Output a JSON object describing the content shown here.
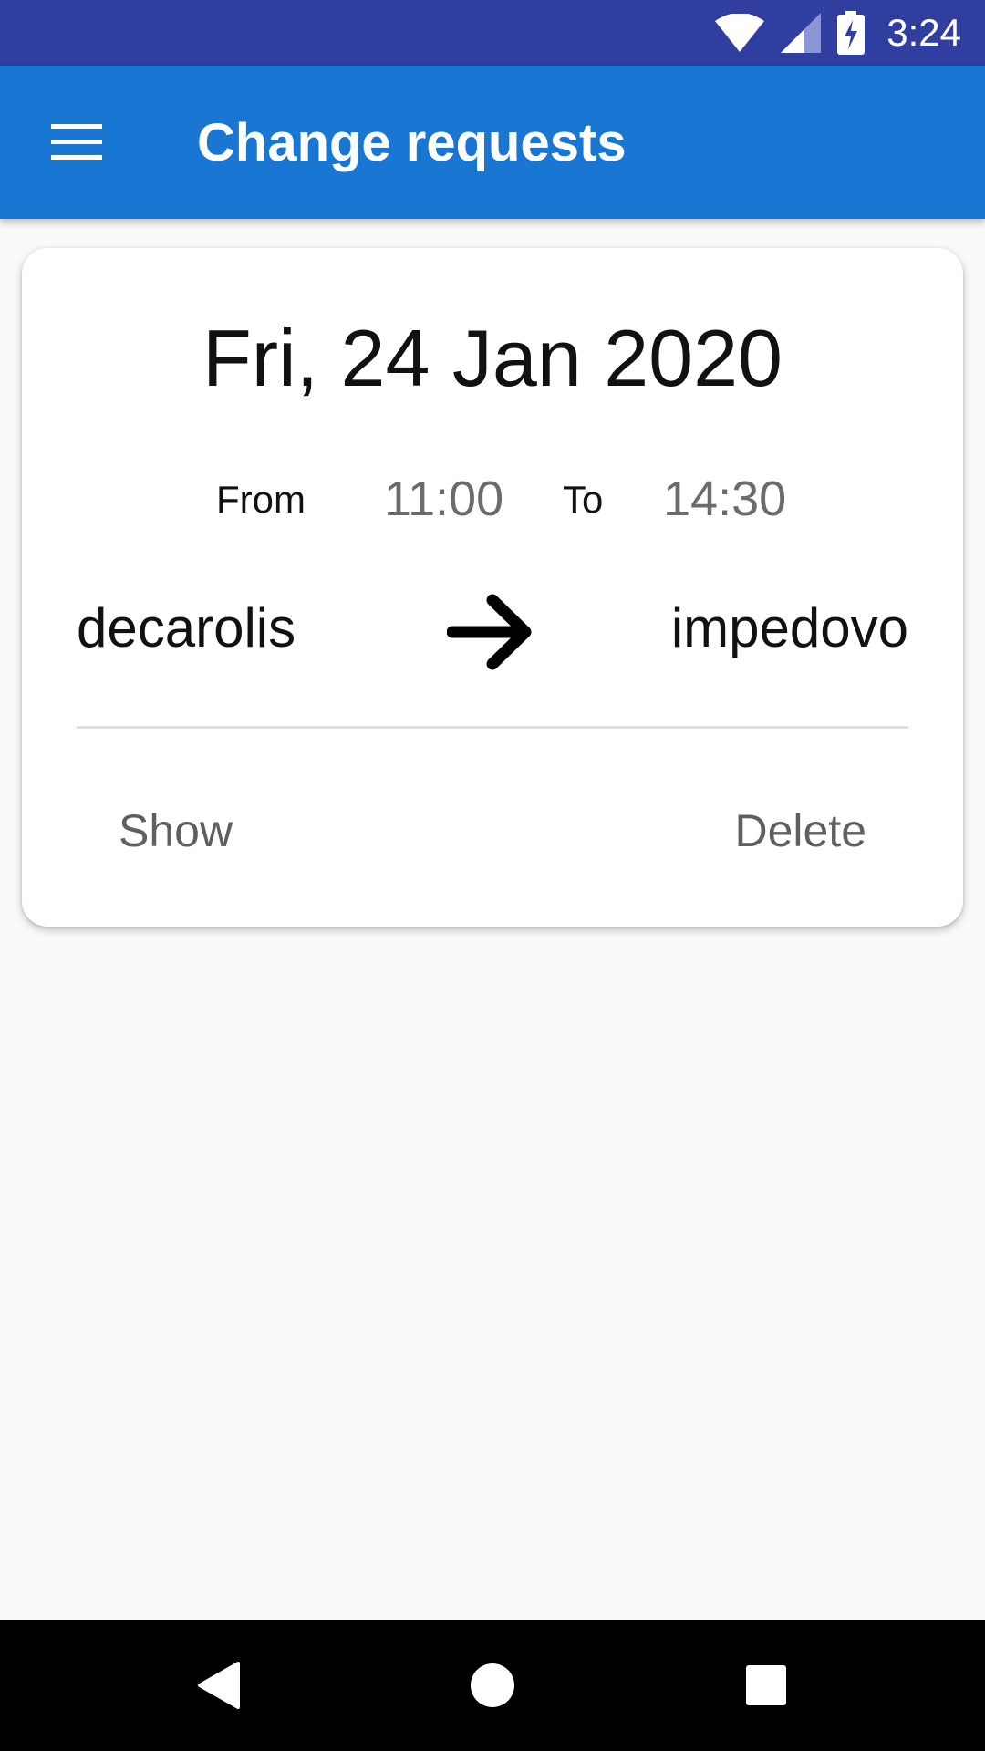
{
  "status_bar": {
    "time": "3:24",
    "icons": [
      "wifi-icon",
      "signal-icon",
      "battery-charging-icon"
    ]
  },
  "app_bar": {
    "menu_icon": "menu-icon",
    "title": "Change requests"
  },
  "request_card": {
    "date": "Fri, 24 Jan 2020",
    "from_label": "From",
    "from_time": "11:00",
    "to_label": "To",
    "to_time": "14:30",
    "from_user": "decarolis",
    "arrow_icon": "arrow-right-icon",
    "to_user": "impedovo",
    "show_label": "Show",
    "delete_label": "Delete"
  },
  "nav_bar": {
    "icons": [
      "back-icon",
      "home-icon",
      "recents-icon"
    ]
  },
  "colors": {
    "status_bar": "#303f9f",
    "app_bar": "#1976d2",
    "background": "#fafafa"
  }
}
